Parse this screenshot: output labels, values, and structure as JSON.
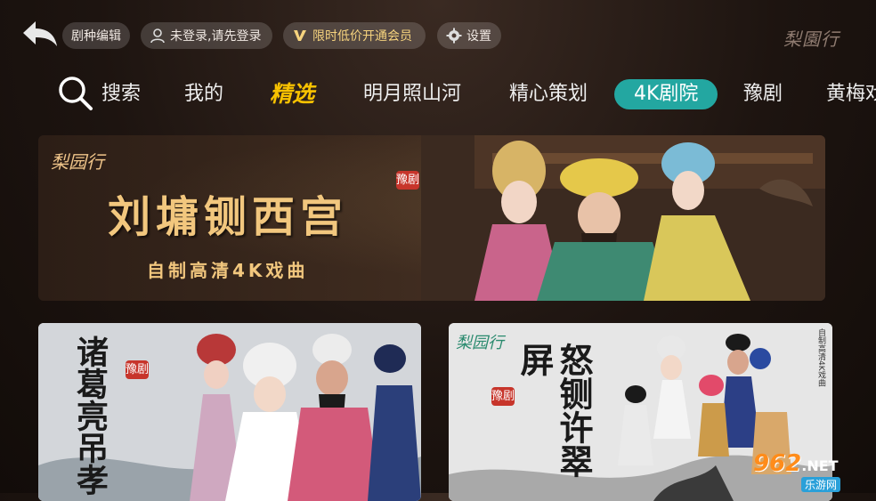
{
  "top_bar": {
    "genre_edit_label": "剧种编辑",
    "login_label": "未登录,请先登录",
    "vip_label": "限时低价开通会员",
    "settings_label": "设置",
    "logo_text": "梨園行"
  },
  "nav": {
    "items": [
      {
        "label": "搜索"
      },
      {
        "label": "我的"
      },
      {
        "label": "精选"
      },
      {
        "label": "明月照山河"
      },
      {
        "label": "精心策划"
      },
      {
        "label": "4K剧院"
      },
      {
        "label": "豫剧"
      },
      {
        "label": "黄梅戏"
      }
    ],
    "active_index": 2,
    "highlighted_index": 5
  },
  "banner": {
    "logo_text": "梨园行",
    "title": "刘墉铡西宫",
    "tag": "豫剧",
    "subtitle": "自制高清4K戏曲"
  },
  "cards": [
    {
      "title": "诸葛亮吊孝",
      "tag": "豫剧"
    },
    {
      "logo_text": "梨园行",
      "title": "怒铡许翠屏",
      "tag": "豫剧",
      "side_text": "自制高清4K戏曲"
    }
  ],
  "watermark": {
    "main": "962",
    "suffix": ".NET",
    "sub": "乐游网"
  },
  "colors": {
    "accent_teal": "#23a7a1",
    "active_yellow": "#f8c200",
    "vip_gold": "#f6d37e",
    "seal_red": "#c7352b"
  }
}
